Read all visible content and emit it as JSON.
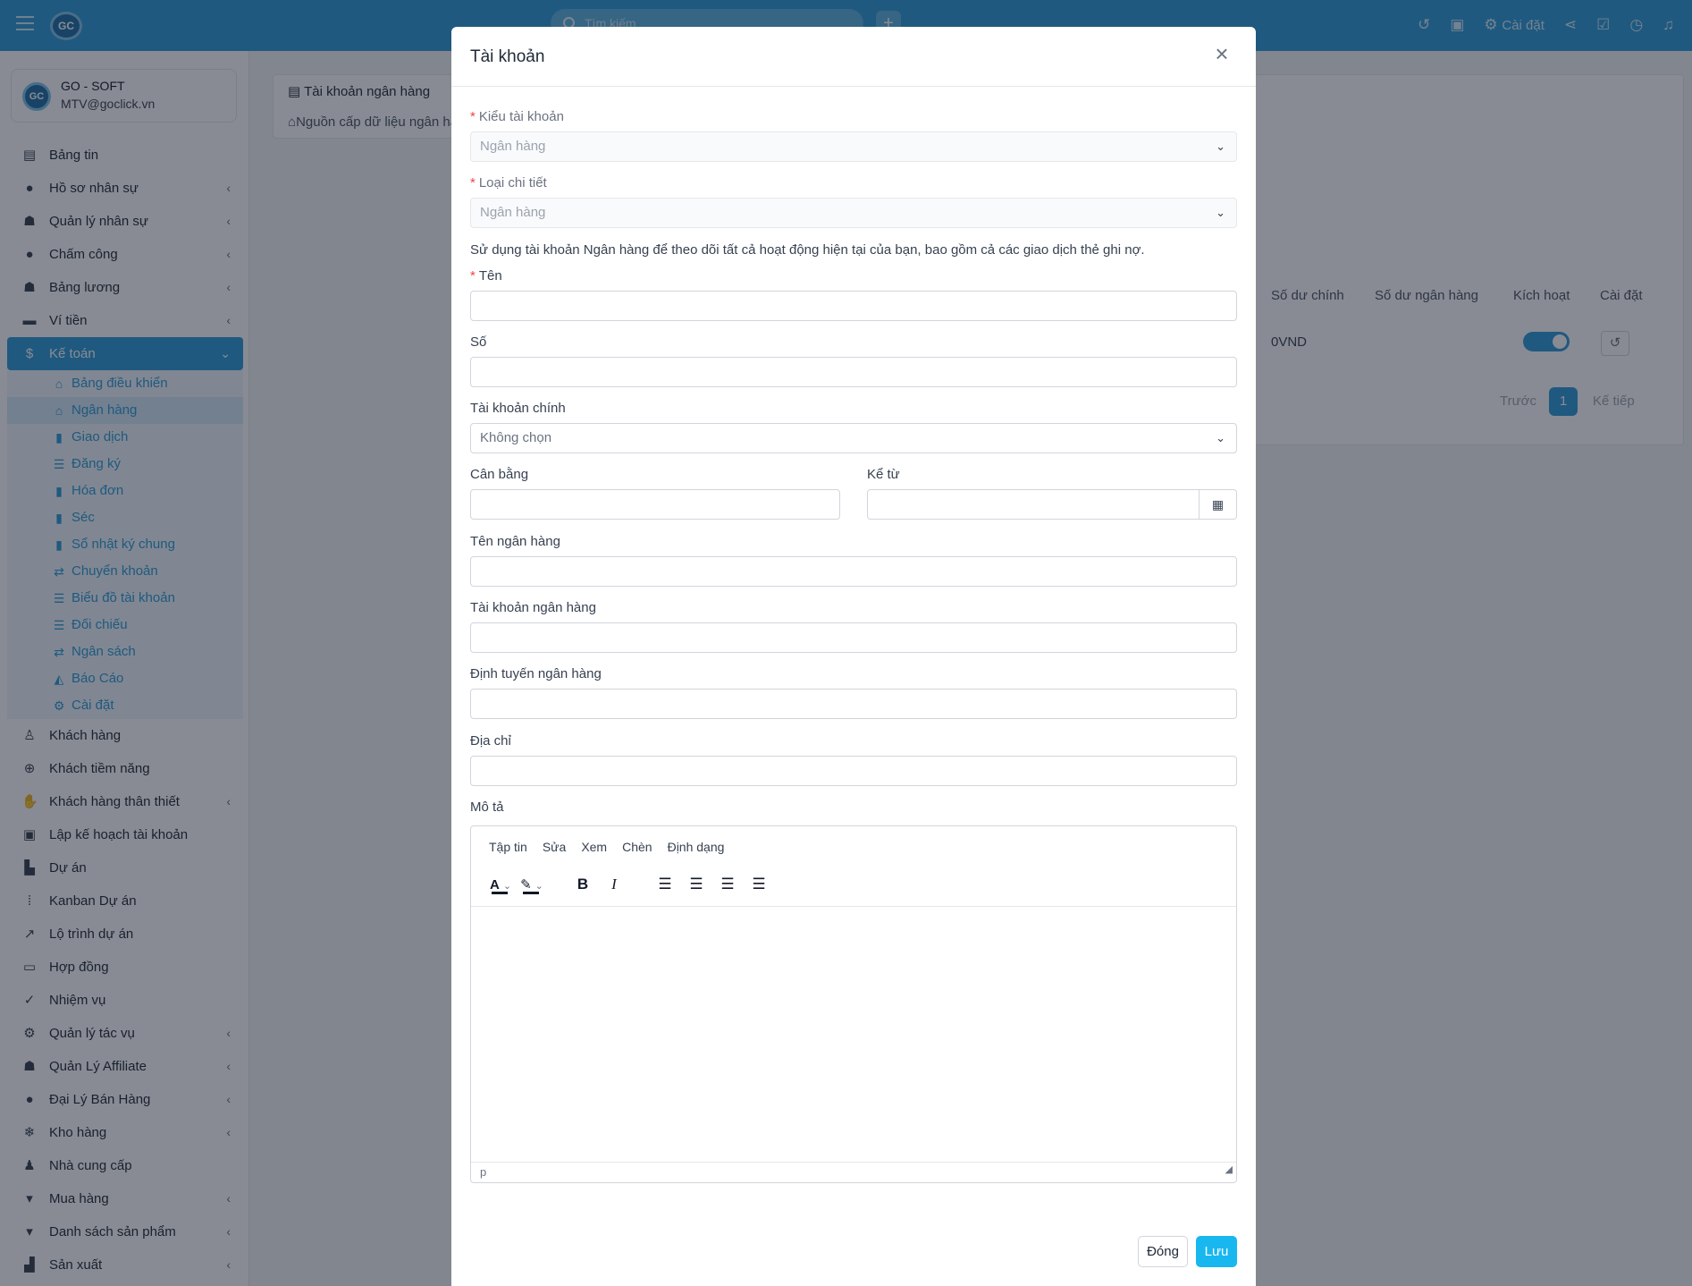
{
  "topbar": {
    "logo_text": "GC",
    "search_placeholder": "Tìm kiếm",
    "plus": "+",
    "settings_label": "Cài đặt"
  },
  "sidebar": {
    "company_logo": "GC",
    "company_name": "GO - SOFT",
    "company_email": "MTV@goclick.vn",
    "items_top": [
      {
        "label": "Bảng tin",
        "icon": "newspaper-icon",
        "glyph": "▤",
        "chevron": false
      },
      {
        "label": "Hồ sơ nhân sự",
        "icon": "user-circle-icon",
        "glyph": "●",
        "chevron": true
      },
      {
        "label": "Quản lý nhân sự",
        "icon": "users-icon",
        "glyph": "☗",
        "chevron": true
      },
      {
        "label": "Chấm công",
        "icon": "user-circle-icon",
        "glyph": "●",
        "chevron": true
      },
      {
        "label": "Bảng lương",
        "icon": "users-icon",
        "glyph": "☗",
        "chevron": true
      },
      {
        "label": "Ví tiền",
        "icon": "wallet-icon",
        "glyph": "▬",
        "chevron": true
      }
    ],
    "active_item": {
      "label": "Kế toán",
      "icon": "dollar-icon",
      "glyph": "$"
    },
    "sub_items": [
      {
        "label": "Bảng điều khiển",
        "icon": "home-icon",
        "glyph": "⌂"
      },
      {
        "label": "Ngân hàng",
        "icon": "bank-icon",
        "glyph": "⌂"
      },
      {
        "label": "Giao dịch",
        "icon": "file-icon",
        "glyph": "▮"
      },
      {
        "label": "Đăng ký",
        "icon": "list-icon",
        "glyph": "☰"
      },
      {
        "label": "Hóa đơn",
        "icon": "book-icon",
        "glyph": "▮"
      },
      {
        "label": "Séc",
        "icon": "book-icon",
        "glyph": "▮"
      },
      {
        "label": "Sổ nhật ký chung",
        "icon": "book-icon",
        "glyph": "▮"
      },
      {
        "label": "Chuyển khoản",
        "icon": "exchange-icon",
        "glyph": "⇄"
      },
      {
        "label": "Biểu đồ tài khoản",
        "icon": "list-icon",
        "glyph": "☰"
      },
      {
        "label": "Đối chiếu",
        "icon": "sliders-icon",
        "glyph": "☰"
      },
      {
        "label": "Ngân sách",
        "icon": "exchange-icon",
        "glyph": "⇄"
      },
      {
        "label": "Báo Cáo",
        "icon": "area-chart-icon",
        "glyph": "◭"
      },
      {
        "label": "Cài đặt",
        "icon": "gear-icon",
        "glyph": "⚙"
      }
    ],
    "items_bottom": [
      {
        "label": "Khách hàng",
        "icon": "user-icon",
        "glyph": "♙",
        "chevron": false
      },
      {
        "label": "Khách tiềm năng",
        "icon": "crosshair-icon",
        "glyph": "⊕",
        "chevron": false
      },
      {
        "label": "Khách hàng thân thiết",
        "icon": "handshake-icon",
        "glyph": "✋",
        "chevron": true
      },
      {
        "label": "Lập kế hoạch tài khoản",
        "icon": "id-card-icon",
        "glyph": "▣",
        "chevron": false
      },
      {
        "label": "Dự án",
        "icon": "chart-bar-icon",
        "glyph": "▙",
        "chevron": false
      },
      {
        "label": "Kanban Dự án",
        "icon": "grip-icon",
        "glyph": "⁞",
        "chevron": false
      },
      {
        "label": "Lộ trình dự án",
        "icon": "chart-line-icon",
        "glyph": "↗",
        "chevron": false
      },
      {
        "label": "Hợp đồng",
        "icon": "note-icon",
        "glyph": "▭",
        "chevron": false
      },
      {
        "label": "Nhiệm vụ",
        "icon": "check-circle-icon",
        "glyph": "✓",
        "chevron": false
      },
      {
        "label": "Quản lý tác vụ",
        "icon": "cogs-icon",
        "glyph": "⚙",
        "chevron": true
      },
      {
        "label": "Quản Lý Affiliate",
        "icon": "users-icon",
        "glyph": "☗",
        "chevron": true
      },
      {
        "label": "Đại Lý Bán Hàng",
        "icon": "user-circle-icon",
        "glyph": "●",
        "chevron": true
      },
      {
        "label": "Kho hàng",
        "icon": "snowflake-icon",
        "glyph": "❄",
        "chevron": true
      },
      {
        "label": "Nhà cung cấp",
        "icon": "user-icon",
        "glyph": "♟",
        "chevron": false
      },
      {
        "label": "Mua hàng",
        "icon": "cart-icon",
        "glyph": "▾",
        "chevron": true
      },
      {
        "label": "Danh sách sản phẩm",
        "icon": "cart-icon",
        "glyph": "▾",
        "chevron": true
      },
      {
        "label": "Sản xuất",
        "icon": "industry-icon",
        "glyph": "▟",
        "chevron": true
      }
    ]
  },
  "main": {
    "left_card": {
      "item1": "Tài khoản ngân hàng",
      "item2": "Nguồn cấp dữ liệu ngân hàng"
    },
    "table": {
      "headers": [
        "Số dư chính",
        "Số dư ngân hàng",
        "Kích hoạt",
        "Cài đặt"
      ],
      "row": {
        "balance": "0VND"
      }
    },
    "pagination": {
      "prev": "Trước",
      "page": "1",
      "next": "Kế tiếp"
    }
  },
  "modal": {
    "title": "Tài khoản",
    "account_type_label": "Kiểu tài khoản",
    "account_type_value": "Ngân hàng",
    "detail_type_label": "Loại chi tiết",
    "detail_type_value": "Ngân hàng",
    "hint": "Sử dụng tài khoản Ngân hàng để theo dõi tất cả hoạt động hiện tại của bạn, bao gồm cả các giao dịch thẻ ghi nợ.",
    "name_label": "Tên",
    "number_label": "Số",
    "parent_label": "Tài khoản chính",
    "parent_value": "Không chọn",
    "balance_label": "Cân bằng",
    "since_label": "Kể từ",
    "bank_name_label": "Tên ngân hàng",
    "bank_account_label": "Tài khoản ngân hàng",
    "routing_label": "Định tuyến ngân hàng",
    "address_label": "Địa chỉ",
    "description_label": "Mô tả",
    "editor": {
      "menu": [
        "Tập tin",
        "Sửa",
        "Xem",
        "Chèn",
        "Định dạng"
      ],
      "status": "p"
    },
    "close_button": "Đóng",
    "save_button": "Lưu"
  },
  "colors": {
    "primary": "#2d9bd6",
    "save": "#19b7f0",
    "required": "#ef4444"
  }
}
